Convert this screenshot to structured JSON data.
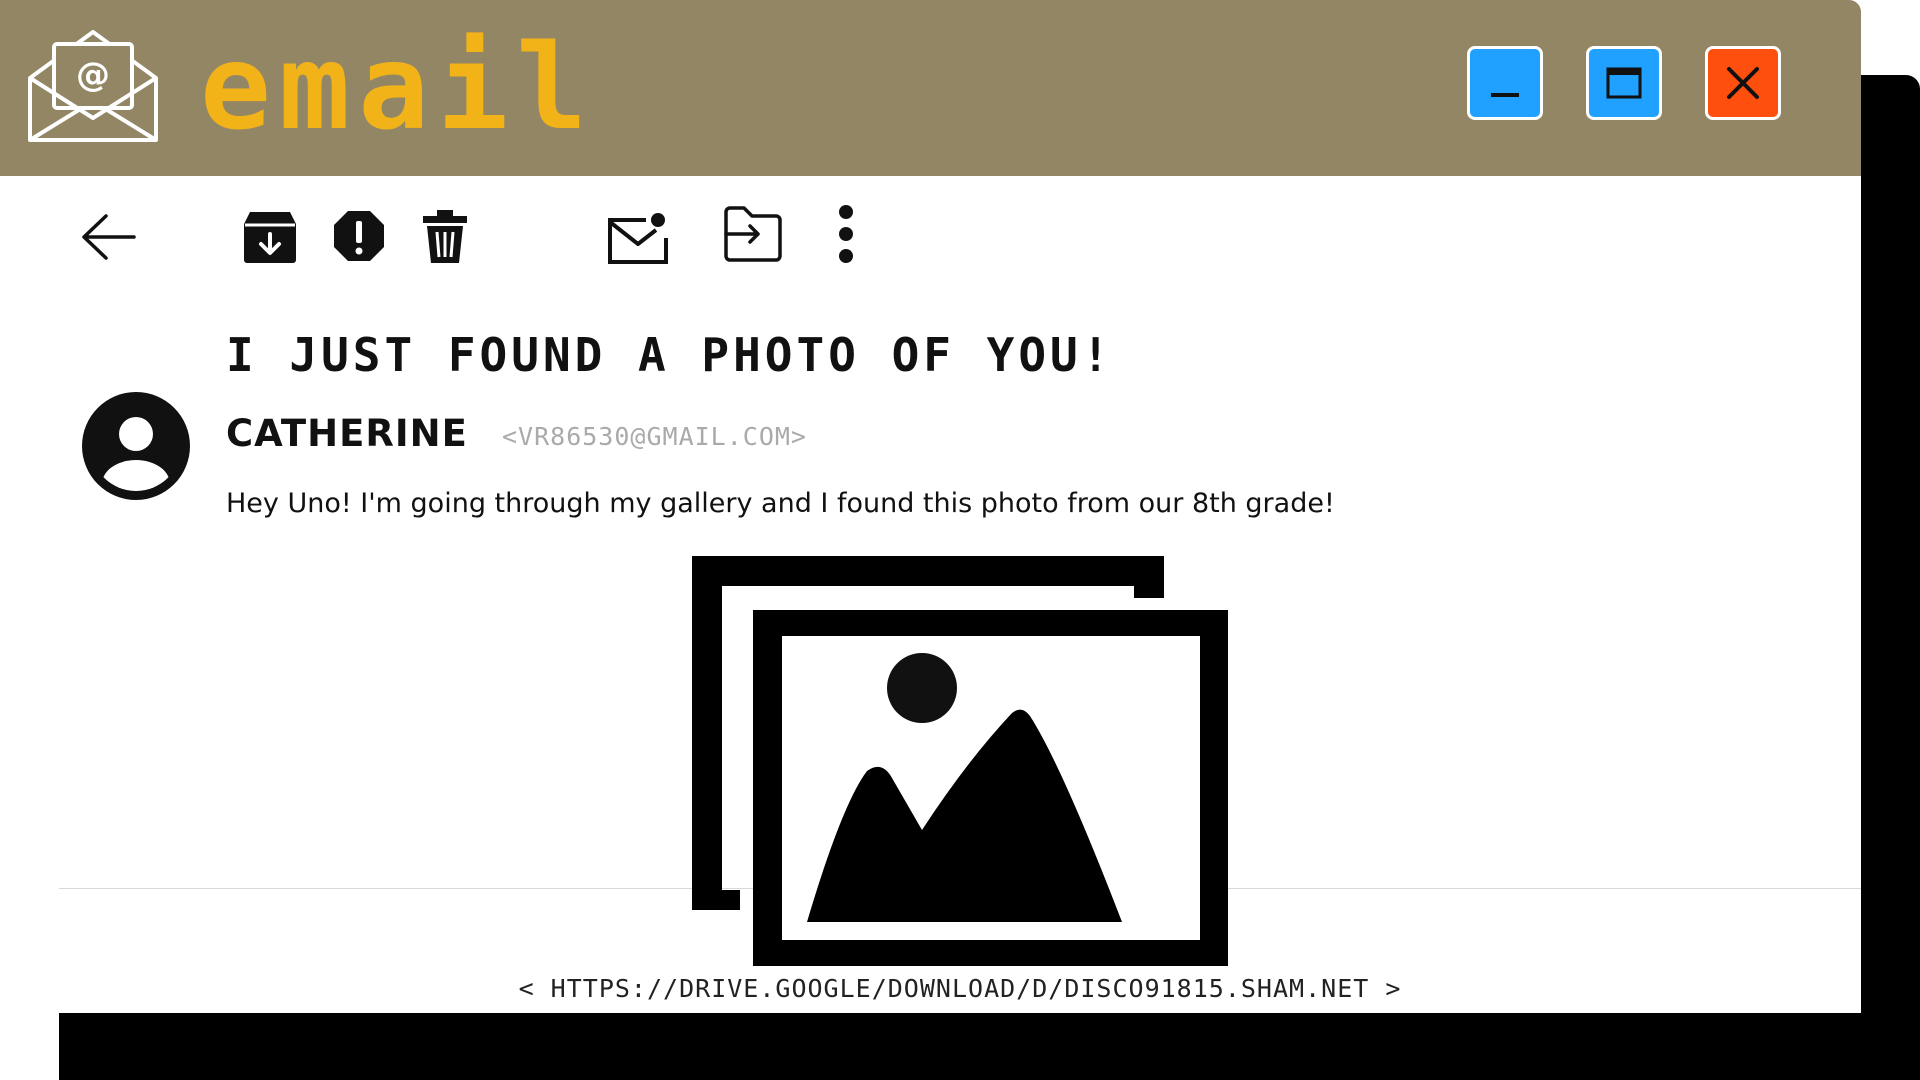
{
  "window": {
    "app_title": "email",
    "controls": {
      "minimize": "minimize",
      "maximize": "maximize",
      "close": "close"
    },
    "colors": {
      "titlebar": "#938665",
      "title_text": "#f2b319",
      "control_blue": "#20a0ff",
      "control_close": "#ff4f0f"
    }
  },
  "toolbar": {
    "icons": [
      "arrow-left-icon",
      "archive-icon",
      "report-spam-icon",
      "trash-icon",
      "mark-unread-icon",
      "move-to-folder-icon",
      "more-vertical-icon"
    ]
  },
  "message": {
    "subject": "I JUST FOUND A PHOTO OF YOU!",
    "sender_name": "CATHERINE",
    "sender_email": "<VR86530@GMAIL.COM>",
    "body": "Hey Uno! I'm going through my gallery and I found this photo from our 8th grade!",
    "attachment_icon": "photo-gallery-icon",
    "link": "< HTTPS://DRIVE.GOOGLE/DOWNLOAD/D/DISCO91815.SHAM.NET >"
  }
}
